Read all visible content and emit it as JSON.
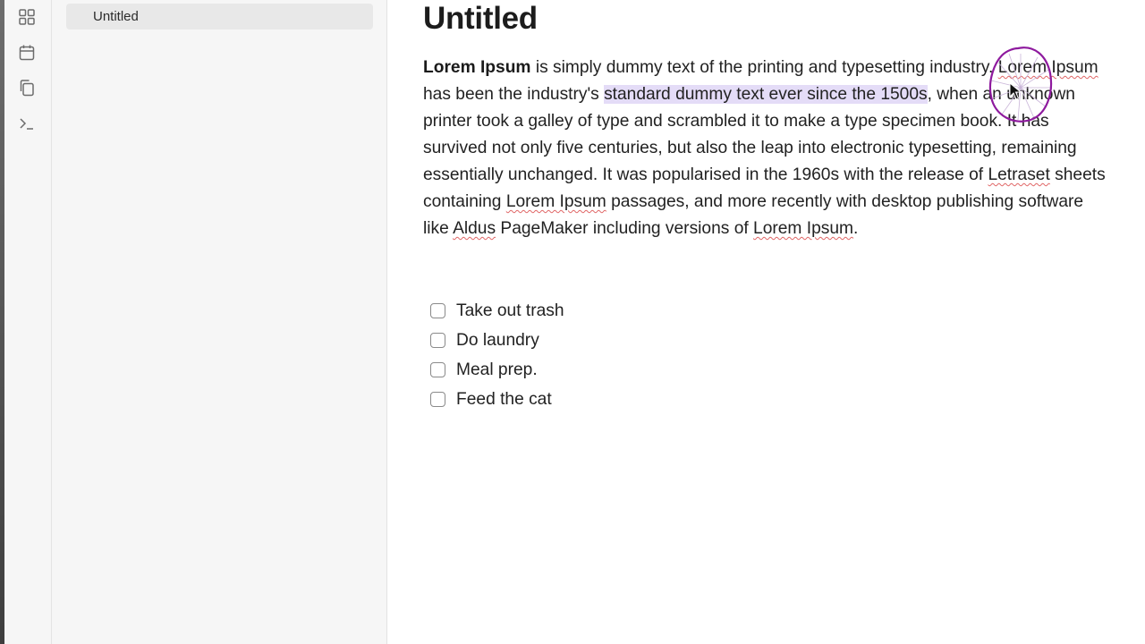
{
  "ribbon": {
    "icons": [
      "grid-icon",
      "calendar-icon",
      "copy-icon",
      "terminal-icon"
    ]
  },
  "file_explorer": {
    "items": [
      {
        "label": "Untitled",
        "active": true
      }
    ]
  },
  "note": {
    "title": "Untitled",
    "paragraph": {
      "p1_bold": "Lorem Ipsum",
      "p2": " is simply dummy text of the printing and typesetting industry. ",
      "p3_sp": "Lorem Ipsum",
      "p4": " has been the industry's ",
      "p5_highlight": "standard dummy text ever since the 1500s",
      "p6": ", when an unknown printer took a galley of type and scrambled it to make a type specimen book. It has survived not only five centuries, but also the leap into electronic typesetting, remaining essentially unchanged. It was popularised in the 1960s with the release of ",
      "p7_sp": "Letraset",
      "p8": " sheets containing ",
      "p9_sp": "Lorem Ipsum",
      "p10": " passages, and more recently with desktop publishing software like ",
      "p11_sp": "Aldus",
      "p12": " PageMaker including versions of ",
      "p13_sp": "Lorem Ipsum",
      "p14": "."
    },
    "tasks": [
      {
        "label": "Take out trash",
        "checked": false
      },
      {
        "label": "Do laundry",
        "checked": false
      },
      {
        "label": "Meal prep.",
        "checked": false
      },
      {
        "label": "Feed the cat",
        "checked": false
      }
    ]
  },
  "colors": {
    "highlight": "#e4dcf7",
    "lasso": "#8e1a9e",
    "spellcheck": "#e06666"
  }
}
